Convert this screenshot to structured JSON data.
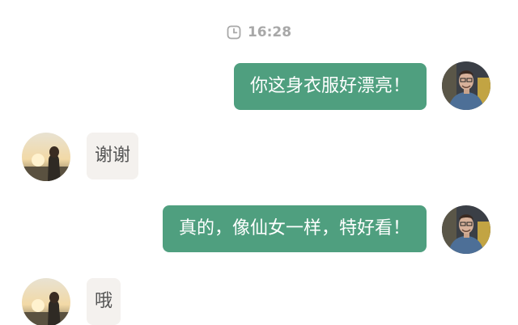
{
  "timestamp": {
    "icon": "clock-icon",
    "time": "16:28"
  },
  "messages": [
    {
      "side": "out",
      "text": "你这身衣服好漂亮！",
      "avatar": "man-avatar"
    },
    {
      "side": "in",
      "text": "谢谢",
      "avatar": "woman-avatar"
    },
    {
      "side": "out",
      "text": "真的，像仙女一样，特好看！",
      "avatar": "man-avatar"
    },
    {
      "side": "in",
      "text": "哦",
      "avatar": "woman-avatar"
    }
  ],
  "colors": {
    "outgoing_bubble": "#4f9f7f",
    "incoming_bubble": "#f4f1ee",
    "timestamp_text": "#a8a8a8"
  }
}
